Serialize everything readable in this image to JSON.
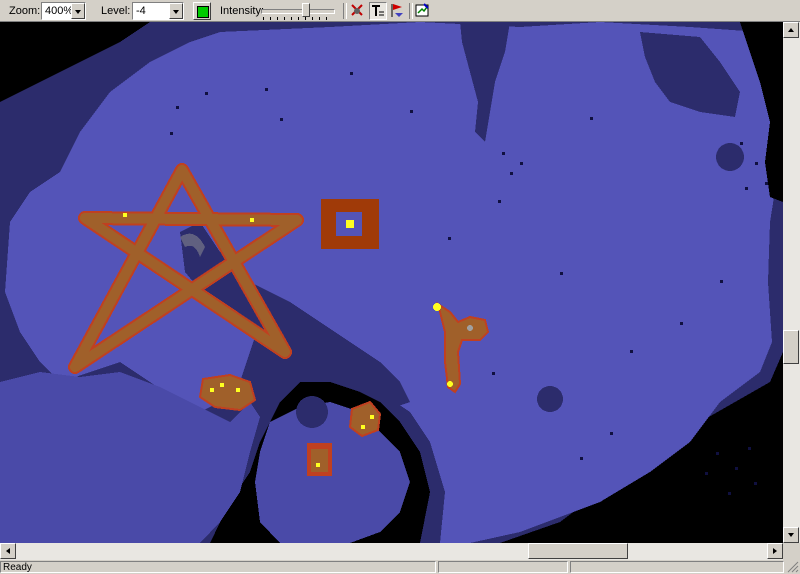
{
  "toolbar": {
    "zoom_label": "Zoom:",
    "zoom_value": "400%",
    "level_label": "Level:",
    "level_value": "-4",
    "intensity_label": "Intensity:",
    "intensity_level": 0.6,
    "color_swatch": "#00cc00"
  },
  "tools": [
    {
      "name": "hide-monsters-icon"
    },
    {
      "name": "text-tool-icon"
    },
    {
      "name": "flag-tool-icon"
    },
    {
      "name": "edit-map-icon"
    }
  ],
  "map": {
    "colors": {
      "background": "#000000",
      "cave_floor": "#5454b8",
      "cave_dark": "#2c2c6c",
      "rock": "#3a3a84",
      "path": "#a0602a",
      "path_edge": "#c04020",
      "marker": "#ffff20",
      "dot": "#101040"
    }
  },
  "statusbar": {
    "text": "Ready"
  }
}
